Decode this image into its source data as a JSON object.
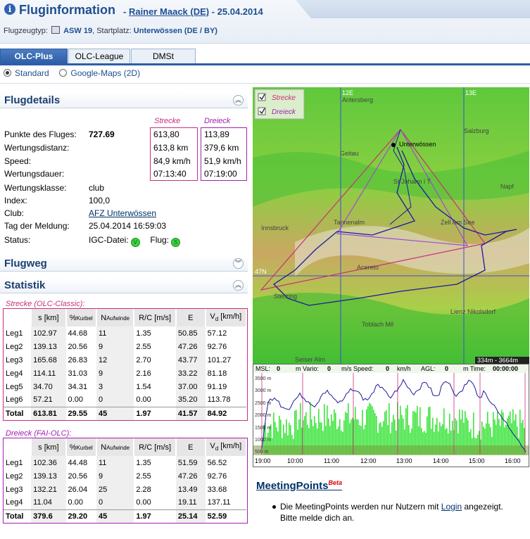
{
  "header": {
    "title": "Fluginformation",
    "pilot": "Rainer Maack (DE)",
    "date": " - 25.04.2014",
    "plane_label": "Flugzeugtyp:",
    "plane": "ASW 19",
    "site_label": ", Startplatz:",
    "site": "Unterwössen (DE / BY)"
  },
  "tabs": [
    "OLC-Plus",
    "OLC-League",
    "DMSt"
  ],
  "views": [
    "Standard",
    "Google-Maps (2D)"
  ],
  "sections": {
    "details": "Flugdetails",
    "route": "Flugweg",
    "stats": "Statistik"
  },
  "details": {
    "col_strecke": "Strecke",
    "col_dreieck": "Dreieck",
    "rows": [
      {
        "label": "Punkte des Fluges:",
        "value": "727.69"
      },
      {
        "label": "Wertungsdistanz:",
        "value": ""
      },
      {
        "label": "Speed:",
        "value": ""
      },
      {
        "label": "Wertungsdauer:",
        "value": ""
      },
      {
        "label": "Wertungsklasse:",
        "value": "club"
      },
      {
        "label": "Index:",
        "value": "100,0"
      },
      {
        "label": "Club:",
        "value": "AFZ Unterwössen"
      },
      {
        "label": "Tag der Meldung:",
        "value": "25.04.2014 16:59:03"
      },
      {
        "label": "Status:",
        "value": ""
      }
    ],
    "strecke": [
      "613,80",
      "613,8 km",
      "84,9 km/h",
      "07:13:40"
    ],
    "dreieck": [
      "113,89",
      "379,6 km",
      "51,9 km/h",
      "07:19:00"
    ],
    "status_igc": "IGC-Datei:",
    "status_flug": "Flug:",
    "igc_mark": "V",
    "flug_mark": "S"
  },
  "stats": {
    "headers": [
      "",
      "s [km]",
      "%Kurbel",
      "NAufwinde",
      "R/C [m/s]",
      "E",
      "Vd [km/h]"
    ],
    "strecke_caption": "Strecke (OLC-Classic):",
    "strecke_rows": [
      [
        "Leg1",
        "102.97",
        "44.68",
        "11",
        "1.35",
        "50.85",
        "57.12"
      ],
      [
        "Leg2",
        "139.13",
        "20.56",
        "9",
        "2.55",
        "47.26",
        "92.76"
      ],
      [
        "Leg3",
        "165.68",
        "26.83",
        "12",
        "2.70",
        "43.77",
        "101.27"
      ],
      [
        "Leg4",
        "114.11",
        "31.03",
        "9",
        "2.16",
        "33.22",
        "81.18"
      ],
      [
        "Leg5",
        "34.70",
        "34.31",
        "3",
        "1.54",
        "37.00",
        "91.19"
      ],
      [
        "Leg6",
        "57.21",
        "0.00",
        "0",
        "0.00",
        "35.20",
        "113.78"
      ],
      [
        "Total",
        "613.81",
        "29.55",
        "45",
        "1.97",
        "41.57",
        "84.92"
      ]
    ],
    "dreieck_caption": "Dreieck (FAI-OLC):",
    "dreieck_rows": [
      [
        "Leg1",
        "102.36",
        "44.48",
        "11",
        "1.35",
        "51.59",
        "56.52"
      ],
      [
        "Leg2",
        "139.13",
        "20.56",
        "9",
        "2.55",
        "47.26",
        "92.76"
      ],
      [
        "Leg3",
        "132.21",
        "26.04",
        "25",
        "2.28",
        "13.49",
        "33.68"
      ],
      [
        "Leg4",
        "11.04",
        "0.00",
        "0",
        "0.00",
        "19.11",
        "137.11"
      ],
      [
        "Total",
        "379.6",
        "29.20",
        "45",
        "1.97",
        "25.14",
        "52.59"
      ]
    ]
  },
  "map": {
    "legend": [
      "Strecke",
      "Dreieck"
    ],
    "places": [
      "Antersberg",
      "Salzburg",
      "Unterwössen",
      "Geitau",
      "St Johann i T",
      "Napf",
      "Innsbruck",
      "Tannenalm",
      "Zell Am See",
      "Acereto",
      "Sterzing",
      "Lienz Nikolsdorf",
      "Toblach Mil",
      "Seiser Alm"
    ],
    "grid": [
      "12E",
      "13E",
      "47N"
    ],
    "scale": "334m - 3664m"
  },
  "chart": {
    "msl_label": "MSL:",
    "msl": "0",
    "mvario_label": "m Vario:",
    "vario": "0",
    "speed_label": "m/s Speed:",
    "speed": "0",
    "kmh_label": "km/h",
    "agl_label": "AGL:",
    "agl": "0",
    "mtime_label": "m Time:",
    "time": "00:00:00",
    "y_ticks": [
      "3500 m",
      "3000 m",
      "2500 m",
      "2000 m",
      "1500 m",
      "1000 m",
      "500 m"
    ],
    "x_ticks": [
      "19:00",
      "10:00",
      "11:00",
      "12:00",
      "13:00",
      "14:00",
      "15:00",
      "16:00"
    ]
  },
  "meeting": {
    "title": "MeetingPoints",
    "beta": "Beta",
    "text_pre": "Die MeetingPoints werden nur Nutzern mit ",
    "link": "Login",
    "text_post": " angezeigt. Bitte melde dich an."
  },
  "colors": {
    "accent": "#1f4f91",
    "tab_active": "#2d5ea8",
    "box": "#b03a80",
    "strecke": "#c8307a",
    "dreieck": "#a020b0"
  }
}
